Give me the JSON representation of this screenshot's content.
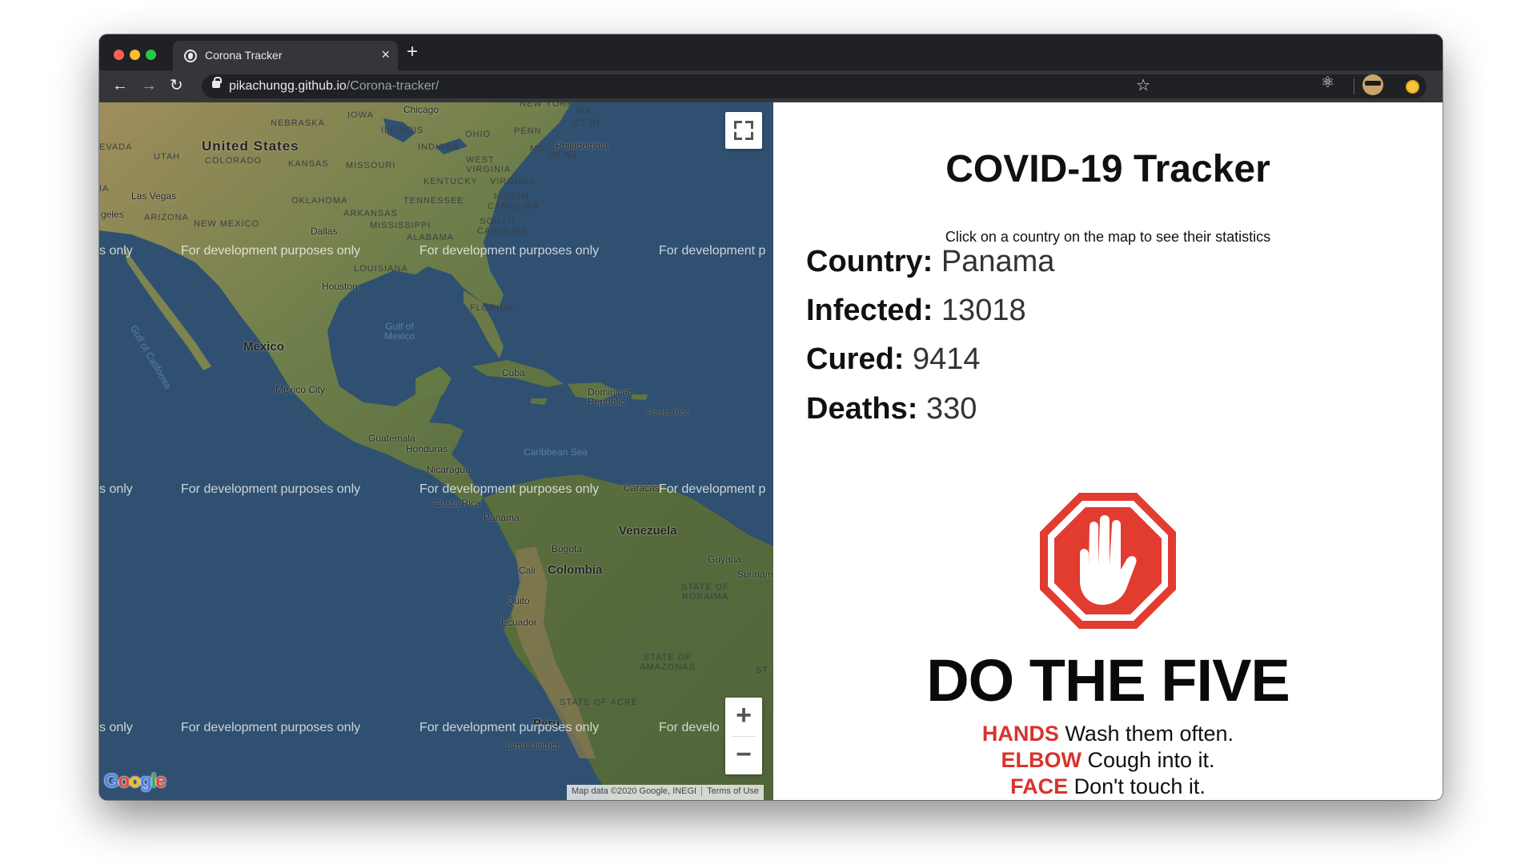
{
  "browser": {
    "tab_title": "Corona Tracker",
    "tab_close": "×",
    "new_tab": "+",
    "url_host": "pikachungg.github.io",
    "url_path": "/Corona-tracker/",
    "icons": {
      "back": "arrow-left-icon",
      "forward": "arrow-right-icon",
      "reload": "reload-icon",
      "lock": "lock-icon",
      "bookmark": "star-icon",
      "extension": "react-atom-icon",
      "profile": "avatar",
      "extension2": "coin-icon"
    }
  },
  "map": {
    "labels": {
      "united_states": "United States",
      "nebraska": "NEBRASKA",
      "iowa": "IOWA",
      "illinois": "ILLINOIS",
      "indiana": "INDIANA",
      "ohio": "OHIO",
      "penn": "PENN",
      "new_york": "NEW YORK",
      "ma": "MA",
      "ct_ri": "CT RI",
      "nevada": "EVADA",
      "utah": "UTAH",
      "colorado": "COLORADO",
      "kansas": "KANSAS",
      "missouri": "MISSOURI",
      "west_virginia": "WEST VIRGINIA",
      "md": "MD",
      "de_nj": "DE NJ",
      "kentucky": "KENTUCKY",
      "virginia": "VIRGINIA",
      "oklahoma": "OKLAHOMA",
      "arkansas": "ARKANSAS",
      "tennessee": "TENNESSEE",
      "north_carolina": "NORTH CAROLINA",
      "arizona": "ARIZONA",
      "new_mexico": "NEW MEXICO",
      "mississippi": "MISSISSIPPI",
      "alabama": "ALABAMA",
      "south_carolina": "SOUTH CAROLINA",
      "louisiana": "LOUISIANA",
      "florida": "FLORIDA",
      "gulf_of_california": "Gulf of California",
      "gulf_of_mexico": "Gulf of Mexico",
      "caribbean_sea": "Caribbean Sea",
      "chicago": "Chicago",
      "philadelphia": "Philadelphia",
      "las_vegas": "Las Vegas",
      "angeles": "geles",
      "dallas": "Dallas",
      "houston": "Houston",
      "mexico": "Mexico",
      "mexico_city": "Mexico City",
      "cuba": "Cuba",
      "dominican_republic": "Dominican Republic",
      "puerto_rico": "Puerto Rico",
      "guatemala": "Guatemala",
      "honduras": "Honduras",
      "nicaragua": "Nicaragua",
      "costa_rica": "Costa Rica",
      "panama": "Panama",
      "caracas": "Caracas",
      "venezuela": "Venezuela",
      "bogota": "Bogota",
      "colombia": "Colombia",
      "cali": "Cali",
      "guyana": "Guyana",
      "suriname": "Surinam",
      "roraima": "STATE OF RORAIMA",
      "quito": "Quito",
      "ecuador": "Ecuador",
      "amazonas": "STATE OF AMAZONAS",
      "acre": "STATE OF ACRE",
      "peru": "Peru",
      "lima": "Lima District",
      "st": "ST",
      "ia": "IA"
    },
    "watermark": "For development purposes only",
    "watermark_partial_left": "s only",
    "watermark_partial_right": "For development p",
    "watermark_partial_right2": "For develo",
    "zoom_in": "+",
    "zoom_out": "−",
    "google_logo": "Google",
    "attribution": "Map data ©2020 Google, INEGI",
    "terms": "Terms of Use",
    "land_color": "#8a8f5a",
    "water_color": "#2f5070"
  },
  "panel": {
    "title": "COVID-19 Tracker",
    "subtitle": "Click on a country on the map to see their statistics",
    "country_label": "Country:",
    "country_value": "Panama",
    "infected_label": "Infected:",
    "infected_value": "13018",
    "cured_label": "Cured:",
    "cured_value": "9414",
    "deaths_label": "Deaths:",
    "deaths_value": "330",
    "stop_color": "#e23b30",
    "do_the_five": "DO THE FIVE",
    "hands_kw": "HANDS",
    "hands_text": "Wash them often.",
    "elbow_kw": "ELBOW",
    "elbow_text": "Cough into it.",
    "face_kw": "FACE",
    "face_text": "Don't touch it."
  }
}
